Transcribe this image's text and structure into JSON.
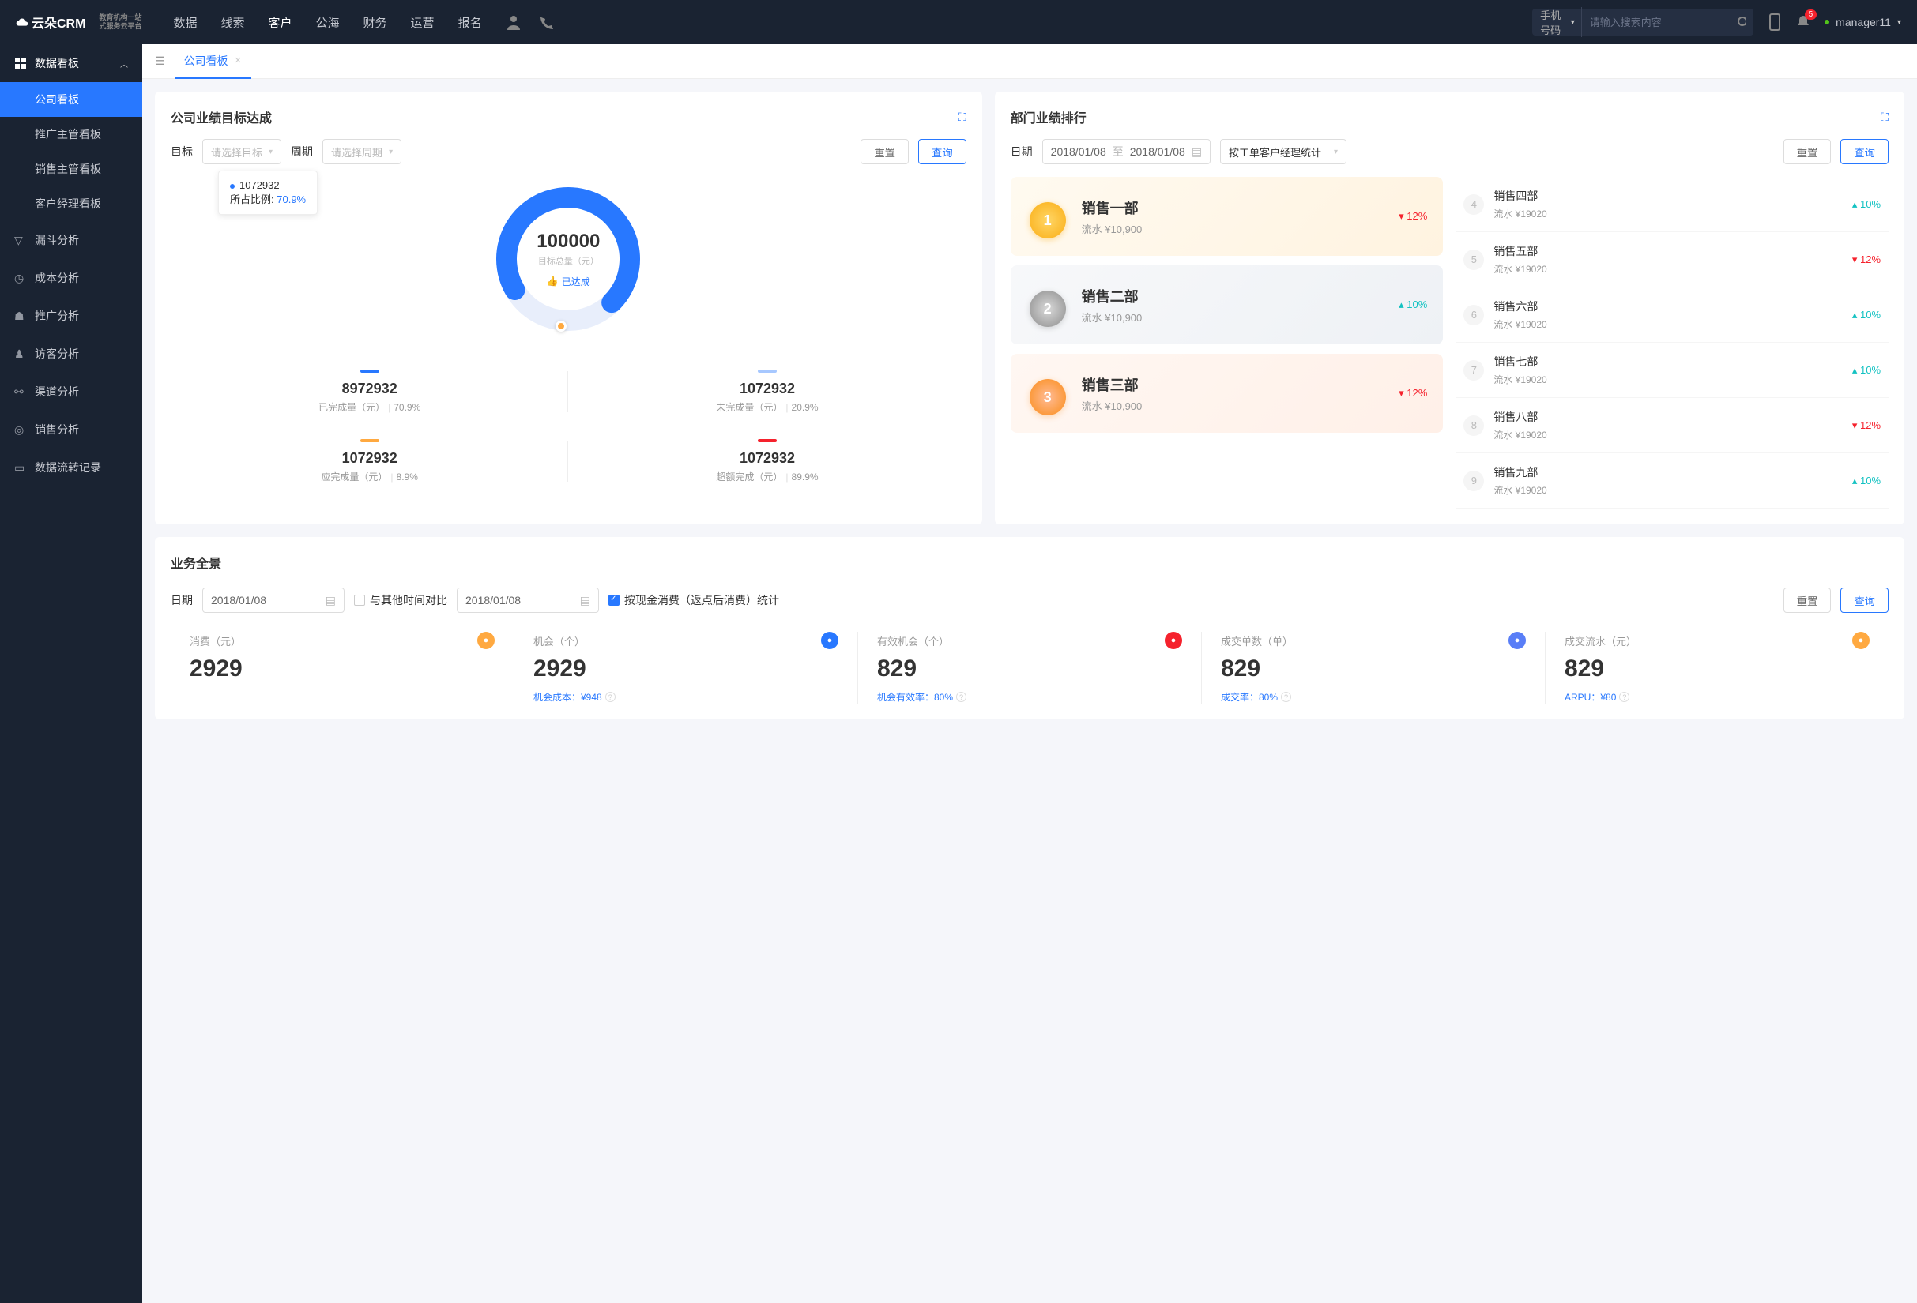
{
  "logo": {
    "brand": "云朵CRM",
    "tag1": "教育机构一站",
    "tag2": "式服务云平台"
  },
  "nav": {
    "items": [
      "数据",
      "线索",
      "客户",
      "公海",
      "财务",
      "运营",
      "报名"
    ],
    "active_index": 2
  },
  "search": {
    "type": "手机号码",
    "placeholder": "请输入搜索内容"
  },
  "notif_count": "5",
  "user": "manager11",
  "sidebar": {
    "group_title": "数据看板",
    "items": [
      "公司看板",
      "推广主管看板",
      "销售主管看板",
      "客户经理看板"
    ],
    "active_index": 0,
    "links": [
      "漏斗分析",
      "成本分析",
      "推广分析",
      "访客分析",
      "渠道分析",
      "销售分析",
      "数据流转记录"
    ]
  },
  "tab": "公司看板",
  "p1": {
    "title": "公司业绩目标达成",
    "target_label": "目标",
    "target_ph": "请选择目标",
    "period_label": "周期",
    "period_ph": "请选择周期",
    "reset": "重置",
    "query": "查询",
    "tooltip_value": "1072932",
    "tooltip_ratio_label": "所占比例:",
    "tooltip_ratio": "70.9%",
    "donut_value": "100000",
    "donut_label": "目标总量（元）",
    "achieved": "已达成",
    "metrics": [
      {
        "bar": "#2878ff",
        "v": "8972932",
        "l": "已完成量（元）",
        "p": "70.9%"
      },
      {
        "bar": "#a7c8ff",
        "v": "1072932",
        "l": "未完成量（元）",
        "p": "20.9%"
      },
      {
        "bar": "#ffa940",
        "v": "1072932",
        "l": "应完成量（元）",
        "p": "8.9%"
      },
      {
        "bar": "#f5222d",
        "v": "1072932",
        "l": "超额完成（元）",
        "p": "89.9%"
      }
    ]
  },
  "p2": {
    "title": "部门业绩排行",
    "date_label": "日期",
    "date_from": "2018/01/08",
    "date_to": "2018/01/08",
    "date_sep": "至",
    "stat": "按工单客户经理统计",
    "reset": "重置",
    "query": "查询",
    "top3": [
      {
        "rank": "1",
        "name": "销售一部",
        "sub": "流水 ¥10,900",
        "change": "12%",
        "dir": "down"
      },
      {
        "rank": "2",
        "name": "销售二部",
        "sub": "流水 ¥10,900",
        "change": "10%",
        "dir": "up"
      },
      {
        "rank": "3",
        "name": "销售三部",
        "sub": "流水 ¥10,900",
        "change": "12%",
        "dir": "down"
      }
    ],
    "rest": [
      {
        "rank": "4",
        "name": "销售四部",
        "sub": "流水 ¥19020",
        "change": "10%",
        "dir": "up"
      },
      {
        "rank": "5",
        "name": "销售五部",
        "sub": "流水 ¥19020",
        "change": "12%",
        "dir": "down"
      },
      {
        "rank": "6",
        "name": "销售六部",
        "sub": "流水 ¥19020",
        "change": "10%",
        "dir": "up"
      },
      {
        "rank": "7",
        "name": "销售七部",
        "sub": "流水 ¥19020",
        "change": "10%",
        "dir": "up"
      },
      {
        "rank": "8",
        "name": "销售八部",
        "sub": "流水 ¥19020",
        "change": "12%",
        "dir": "down"
      },
      {
        "rank": "9",
        "name": "销售九部",
        "sub": "流水 ¥19020",
        "change": "10%",
        "dir": "up"
      }
    ]
  },
  "p3": {
    "title": "业务全景",
    "date_label": "日期",
    "date": "2018/01/08",
    "compare_label": "与其他时间对比",
    "date2": "2018/01/08",
    "cash_label": "按现金消费（返点后消费）统计",
    "reset": "重置",
    "query": "查询",
    "kpis": [
      {
        "label": "消费（元）",
        "icon_bg": "#ffa940",
        "value": "2929",
        "sub": ""
      },
      {
        "label": "机会（个）",
        "icon_bg": "#2878ff",
        "value": "2929",
        "sub": "机会成本：¥948"
      },
      {
        "label": "有效机会（个）",
        "icon_bg": "#f5222d",
        "value": "829",
        "sub": "机会有效率：80%"
      },
      {
        "label": "成交单数（单）",
        "icon_bg": "#597ef7",
        "value": "829",
        "sub": "成交率：80%"
      },
      {
        "label": "成交流水（元）",
        "icon_bg": "#ffa940",
        "value": "829",
        "sub": "ARPU：¥80"
      }
    ]
  },
  "chart_data": {
    "type": "pie",
    "title": "公司业绩目标达成",
    "total": 100000,
    "series": [
      {
        "name": "已完成量",
        "value": 8972932,
        "pct": 70.9,
        "color": "#2878ff"
      },
      {
        "name": "未完成量",
        "value": 1072932,
        "pct": 20.9,
        "color": "#a7c8ff"
      },
      {
        "name": "应完成量",
        "value": 1072932,
        "pct": 8.9,
        "color": "#ffa940"
      },
      {
        "name": "超额完成",
        "value": 1072932,
        "pct": 89.9,
        "color": "#f5222d"
      }
    ]
  }
}
